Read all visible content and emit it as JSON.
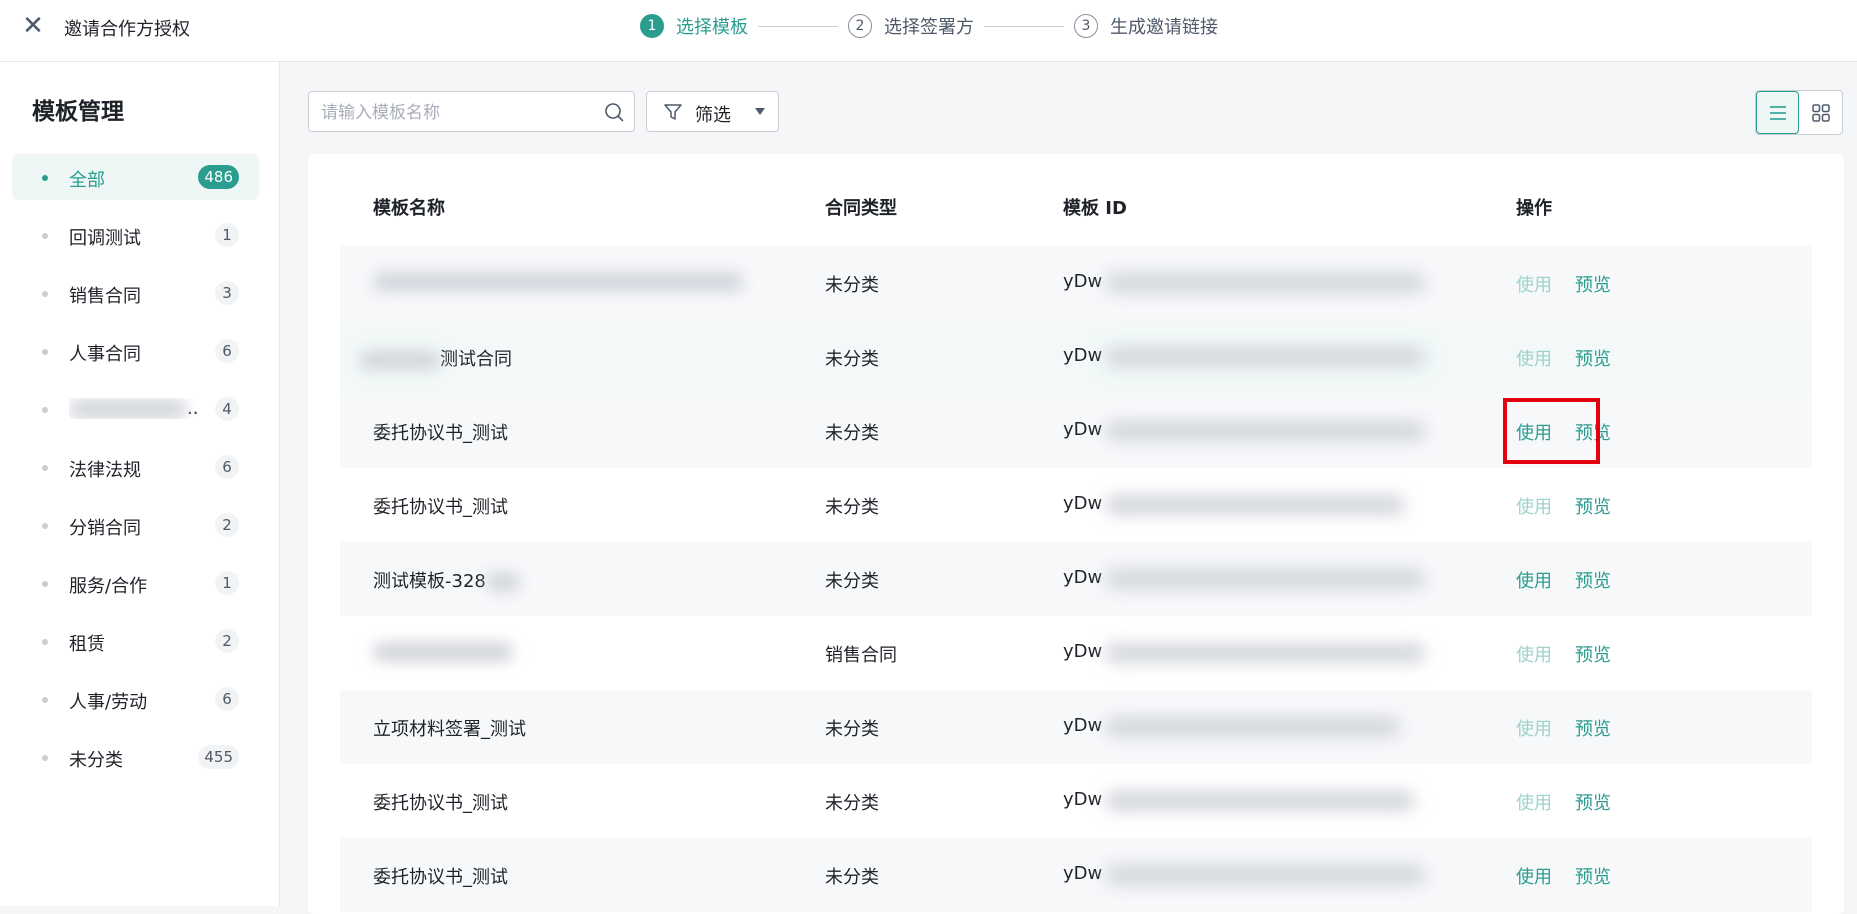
{
  "header": {
    "title": "邀请合作方授权",
    "steps": [
      {
        "num": "1",
        "label": "选择模板"
      },
      {
        "num": "2",
        "label": "选择签署方"
      },
      {
        "num": "3",
        "label": "生成邀请链接"
      }
    ]
  },
  "sidebar": {
    "title": "模板管理",
    "items": [
      {
        "label": "全部",
        "count": "486"
      },
      {
        "label": "回调测试",
        "count": "1"
      },
      {
        "label": "销售合同",
        "count": "3"
      },
      {
        "label": "人事合同",
        "count": "6"
      },
      {
        "label": "",
        "count": "4"
      },
      {
        "label": "法律法规",
        "count": "6"
      },
      {
        "label": "分销合同",
        "count": "2"
      },
      {
        "label": "服务/合作",
        "count": "1"
      },
      {
        "label": "租赁",
        "count": "2"
      },
      {
        "label": "人事/劳动",
        "count": "6"
      },
      {
        "label": "未分类",
        "count": "455"
      }
    ]
  },
  "toolbar": {
    "search_placeholder": "请输入模板名称",
    "filter_label": "筛选"
  },
  "table": {
    "columns": [
      "模板名称",
      "合同类型",
      "模板 ID",
      "操作"
    ],
    "rows": [
      {
        "name": "",
        "type": "未分类",
        "id": "yDw",
        "use": "使用",
        "preview": "预览"
      },
      {
        "name": "测试合同",
        "type": "未分类",
        "id": "yDw",
        "use": "使用",
        "preview": "预览"
      },
      {
        "name": "委托协议书_测试",
        "type": "未分类",
        "id": "yDw",
        "use": "使用",
        "preview": "预览"
      },
      {
        "name": "委托协议书_测试",
        "type": "未分类",
        "id": "yDw",
        "use": "使用",
        "preview": "预览"
      },
      {
        "name": "测试模板-328",
        "type": "未分类",
        "id": "yDw",
        "use": "使用",
        "preview": "预览"
      },
      {
        "name": "",
        "type": "销售合同",
        "id": "yDw",
        "use": "使用",
        "preview": "预览"
      },
      {
        "name": "立项材料签署_测试",
        "type": "未分类",
        "id": "yDw",
        "use": "使用",
        "preview": "预览"
      },
      {
        "name": "委托协议书_测试",
        "type": "未分类",
        "id": "yDw",
        "use": "使用",
        "preview": "预览"
      },
      {
        "name": "委托协议书_测试",
        "type": "未分类",
        "id": "yDw",
        "use": "使用",
        "preview": "预览"
      }
    ]
  },
  "colors": {
    "accent": "#2a9d8f",
    "accent_faded": "#9fd2cb",
    "highlight": "#e3000f"
  }
}
